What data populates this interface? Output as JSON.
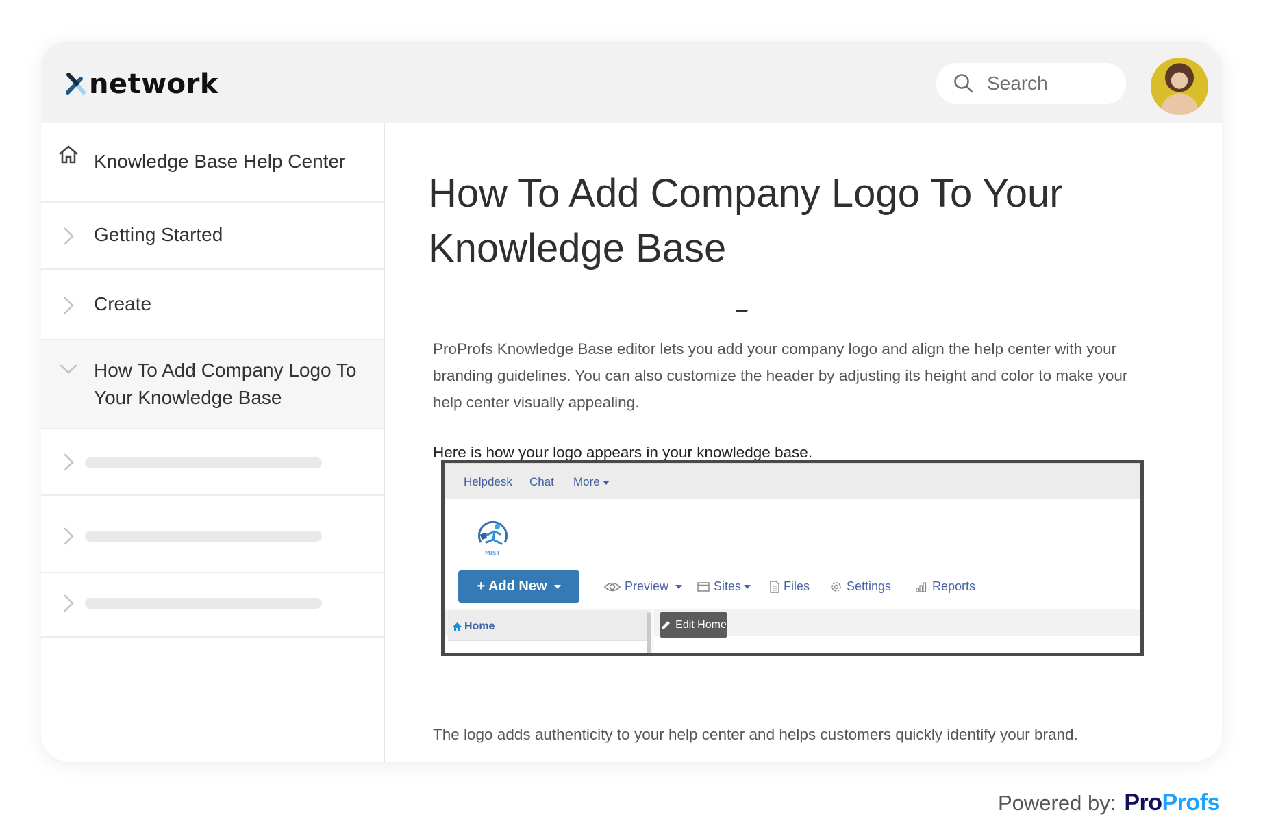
{
  "header": {
    "brand_name": "network",
    "search_placeholder": "Search",
    "avatar_alt": "User avatar"
  },
  "sidebar": {
    "home": {
      "label": "Knowledge Base Help Center",
      "icon": "home-icon"
    },
    "items": [
      {
        "label": "Getting Started",
        "icon": "chevron-right-icon",
        "expanded": false
      },
      {
        "label": "Create",
        "icon": "chevron-right-icon",
        "expanded": false
      },
      {
        "label": "How To Add Company Logo To Your Knowledge Base",
        "icon": "chevron-down-icon",
        "expanded": true,
        "active": true
      }
    ],
    "placeholder_items": 3
  },
  "article": {
    "title": "How To Add Company Logo To Your Knowledge Base",
    "intro": "ProProfs Knowledge Base editor lets you add your company logo and align the help center with your branding guidelines. You can also customize the header by adjusting its height and color to make your help center visually appealing.",
    "lead_in": "Here is how your logo appears in your knowledge base.",
    "closing": "The logo adds authenticity to your help center and helps customers quickly identify your brand."
  },
  "embedded_screenshot": {
    "nav": [
      "Helpdesk",
      "Chat",
      "More"
    ],
    "logo_text": "MIST",
    "add_new_label": "+ Add New",
    "toolbar": [
      {
        "label": "Preview",
        "icon": "eye-icon",
        "dropdown": true
      },
      {
        "label": "Sites",
        "icon": "window-icon",
        "dropdown": true
      },
      {
        "label": "Files",
        "icon": "file-icon",
        "dropdown": false
      },
      {
        "label": "Settings",
        "icon": "gear-icon",
        "dropdown": false
      },
      {
        "label": "Reports",
        "icon": "bar-chart-icon",
        "dropdown": false
      }
    ],
    "home_link": "Home",
    "edit_home_label": "Edit Home"
  },
  "footer": {
    "powered_by": "Powered by:",
    "brand_part1": "Pro",
    "brand_part2": "Profs"
  },
  "colors": {
    "header_bg": "#f2f2f2",
    "active_row_bg": "#f6f6f6",
    "add_new_button": "#3579b5",
    "link_blue": "#3f5fa0",
    "proprofs_dark": "#140f5c",
    "proprofs_light": "#1aa3ff"
  }
}
